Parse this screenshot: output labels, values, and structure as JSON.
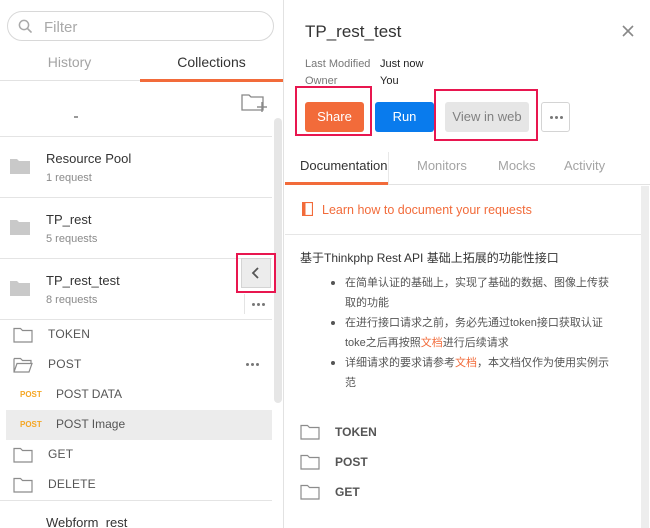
{
  "search": {
    "placeholder": "Filter"
  },
  "left_tabs": {
    "history": "History",
    "collections": "Collections"
  },
  "collections": [
    {
      "name": "Resource Pool",
      "count": "1 request"
    },
    {
      "name": "TP_rest",
      "count": "5 requests"
    },
    {
      "name": "TP_rest_test",
      "count": "8 requests"
    }
  ],
  "tree": {
    "token_folder": "TOKEN",
    "post_folder": "POST",
    "requests": [
      {
        "method": "POST",
        "name": "POST DATA"
      },
      {
        "method": "POST",
        "name": "POST Image"
      }
    ],
    "get_folder": "GET",
    "delete_folder": "DELETE"
  },
  "bottom_collection": "Webform_rest",
  "detail": {
    "title": "TP_rest_test",
    "last_modified_label": "Last Modified",
    "last_modified_value": "Just now",
    "owner_label": "Owner",
    "owner_value": "You",
    "share_label": "Share",
    "run_label": "Run",
    "view_web_label": "View in web"
  },
  "right_tabs": {
    "documentation": "Documentation",
    "monitors": "Monitors",
    "mocks": "Mocks",
    "activity": "Activity"
  },
  "doc": {
    "learn_link": "Learn how to document your requests",
    "heading": "基于Thinkphp Rest API 基础上拓展的功能性接口",
    "bullet1": "在简单认证的基础上，实现了基础的数据、图像上传获取的功能",
    "bullet2_pre": "在进行接口请求之前，务必先通过token接口获取认证toke之后再按照",
    "bullet2_link": "文档",
    "bullet2_post": "进行后续请求",
    "bullet3_pre": "详细请求的要求请参考",
    "bullet3_link": "文档",
    "bullet3_post": "，本文档仅作为使用实例示范",
    "folders": [
      "TOKEN",
      "POST",
      "GET"
    ]
  },
  "colors": {
    "accent_orange": "#f26b3a",
    "run_blue": "#097bed",
    "highlight_red": "#e8164f",
    "method_post": "#f5a623"
  }
}
